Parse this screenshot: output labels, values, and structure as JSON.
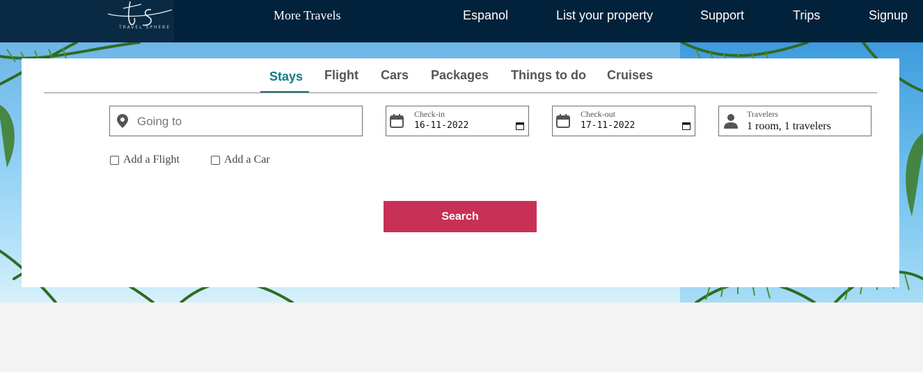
{
  "logo": {
    "monogram": "ts",
    "subtitle": "TRAVEL SPHERE"
  },
  "nav": {
    "more_travels": "More Travels",
    "espanol": "Espanol",
    "list_property": "List your property",
    "support": "Support",
    "trips": "Trips",
    "signup": "Signup"
  },
  "tabs": [
    "Stays",
    "Flight",
    "Cars",
    "Packages",
    "Things to do",
    "Cruises"
  ],
  "active_tab": "Stays",
  "search": {
    "destination_placeholder": "Going to",
    "checkin_label": "Check-in",
    "checkin_value": "16-11-2022",
    "checkout_label": "Check-out",
    "checkout_value": "17-11-2022",
    "travelers_label": "Travelers",
    "travelers_value": "1 room, 1 travelers",
    "add_flight": "Add a Flight",
    "add_car": "Add a Car",
    "button": "Search"
  },
  "colors": {
    "nav_bg": "#02223b",
    "accent_tab": "#127a8a",
    "search_button": "#c93056"
  }
}
